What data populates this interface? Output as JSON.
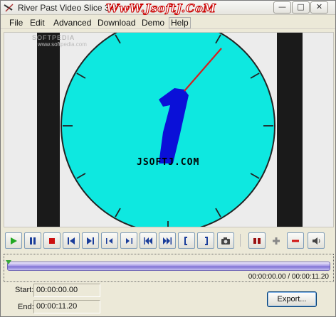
{
  "window": {
    "title": "River Past Video Slice 3.3",
    "watermark": "WwW.JsoftJ.CoM",
    "minimize_glyph": "—",
    "maximize_glyph": "□",
    "close_glyph": "✕"
  },
  "menu": {
    "items": [
      {
        "label": "File"
      },
      {
        "label": "Edit"
      },
      {
        "label": "Advanced"
      },
      {
        "label": "Download"
      },
      {
        "label": "Demo"
      },
      {
        "label": "Help"
      }
    ]
  },
  "video": {
    "softpedia_logo": "SOFTPEDIA",
    "softpedia_url": "www.softpedia.com",
    "overlay_text": "JSOFTJ.COM",
    "clock_face_color": "#0ee8e0",
    "hour_hand_color": "#0a10d8",
    "second_hand_color": "#d42020"
  },
  "toolbar": {
    "buttons": [
      {
        "name": "play-icon"
      },
      {
        "name": "pause-icon"
      },
      {
        "name": "stop-icon"
      },
      {
        "name": "go-to-start-icon"
      },
      {
        "name": "go-to-end-icon"
      },
      {
        "name": "previous-frame-icon"
      },
      {
        "name": "next-frame-icon"
      },
      {
        "name": "rewind-icon"
      },
      {
        "name": "fast-forward-icon"
      },
      {
        "name": "set-start-marker-icon"
      },
      {
        "name": "set-end-marker-icon"
      },
      {
        "name": "snapshot-camera-icon"
      },
      {
        "name": "split-icon"
      },
      {
        "name": "add-icon"
      },
      {
        "name": "remove-icon"
      },
      {
        "name": "volume-icon"
      }
    ]
  },
  "timeline": {
    "position": 0.0,
    "timecode": "00:00:00.00 / 00:00:11.20"
  },
  "range": {
    "start_label": "Start:",
    "start_value": "00:00:00.00",
    "end_label": "End:",
    "end_value": "00:00:11.20"
  },
  "export": {
    "label": "Export..."
  }
}
